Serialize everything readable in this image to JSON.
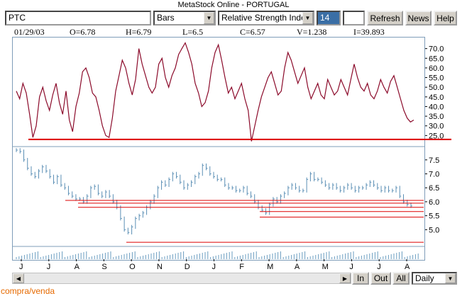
{
  "window": {
    "title": "MetaStock Online - PORTUGAL"
  },
  "toolbar": {
    "symbol_value": "PTC",
    "chart_type_selected": "Bars",
    "indicator_selected": "Relative Strength Index",
    "period_value": "14",
    "extra_field_value": "",
    "refresh_label": "Refresh",
    "news_label": "News",
    "help_label": "Help"
  },
  "quote": {
    "date": "01/29/03",
    "open": "O=6.78",
    "high": "H=6.79",
    "low": "L=6.5",
    "close": "C=6.57",
    "volume": "V=1.238",
    "indicator": "I=39.893"
  },
  "chart_data": [
    {
      "type": "line",
      "panel": "indicator",
      "ylim": [
        20,
        75
      ],
      "y_ticks": [
        "70.0",
        "65.0",
        "60.0",
        "55.0",
        "50.0",
        "45.0",
        "40.0",
        "35.0",
        "30.0",
        "25.0"
      ],
      "values": [
        48,
        44,
        52,
        47,
        36,
        24,
        30,
        45,
        50,
        43,
        38,
        46,
        52,
        42,
        36,
        48,
        33,
        27,
        40,
        47,
        58,
        60,
        55,
        47,
        45,
        38,
        30,
        25,
        24,
        34,
        48,
        56,
        64,
        60,
        52,
        46,
        54,
        70,
        62,
        56,
        50,
        47,
        50,
        62,
        65,
        55,
        50,
        56,
        60,
        67,
        70,
        73,
        68,
        62,
        52,
        47,
        40,
        42,
        48,
        60,
        68,
        72,
        64,
        55,
        47,
        50,
        44,
        48,
        52,
        44,
        38,
        22,
        30,
        38,
        45,
        50,
        55,
        58,
        52,
        46,
        48,
        60,
        68,
        64,
        58,
        52,
        56,
        60,
        50,
        44,
        48,
        52,
        46,
        44,
        54,
        50,
        46,
        48,
        54,
        50,
        46,
        54,
        62,
        55,
        50,
        48,
        52,
        46,
        44,
        48,
        54,
        50,
        47,
        53,
        56,
        50,
        44,
        38,
        34,
        32,
        33
      ],
      "annotations": [
        {
          "type": "horizontal-line",
          "value": 23,
          "color": "#dd0000"
        }
      ]
    },
    {
      "type": "bar",
      "panel": "price",
      "ylim": [
        4.4,
        7.9
      ],
      "y_ticks": [
        "7.5",
        "7.0",
        "6.5",
        "6.0",
        "5.5",
        "5.0"
      ],
      "values": [
        7.85,
        7.8,
        7.5,
        7.2,
        7.0,
        6.9,
        7.1,
        7.25,
        7.1,
        6.9,
        6.7,
        6.9,
        6.6,
        6.5,
        6.3,
        6.2,
        6.1,
        6.1,
        6.0,
        6.2,
        6.5,
        6.55,
        6.3,
        6.2,
        6.35,
        6.2,
        6.0,
        5.8,
        5.4,
        5.0,
        4.9,
        5.1,
        5.4,
        5.5,
        5.6,
        5.8,
        6.0,
        6.2,
        6.5,
        6.7,
        6.6,
        6.8,
        7.0,
        6.9,
        6.7,
        6.5,
        6.6,
        6.7,
        6.9,
        7.0,
        7.3,
        7.2,
        7.0,
        6.9,
        6.8,
        6.8,
        6.6,
        6.5,
        6.5,
        6.4,
        6.4,
        6.5,
        6.3,
        6.2,
        6.0,
        5.8,
        5.7,
        5.6,
        5.9,
        6.1,
        6.0,
        6.2,
        6.3,
        6.5,
        6.6,
        6.5,
        6.4,
        6.4,
        6.8,
        7.0,
        6.8,
        6.8,
        6.7,
        6.6,
        6.5,
        6.6,
        6.5,
        6.4,
        6.5,
        6.6,
        6.5,
        6.4,
        6.5,
        6.5,
        6.6,
        6.7,
        6.6,
        6.5,
        6.4,
        6.5,
        6.4,
        6.4,
        6.5,
        6.2,
        6.0,
        5.9,
        5.85
      ],
      "annotations": [
        {
          "type": "horizontal-line",
          "value": 6.05,
          "color": "#dd0000"
        },
        {
          "type": "horizontal-line",
          "value": 5.95,
          "color": "#dd0000"
        },
        {
          "type": "horizontal-line",
          "value": 5.8,
          "color": "#dd0000"
        },
        {
          "type": "horizontal-line",
          "value": 5.65,
          "color": "#dd0000"
        },
        {
          "type": "horizontal-line",
          "value": 5.45,
          "color": "#dd0000"
        },
        {
          "type": "horizontal-line",
          "value": 4.55,
          "color": "#dd0000"
        }
      ]
    },
    {
      "type": "bar",
      "panel": "volume",
      "x_ticks": [
        "J",
        "J",
        "A",
        "S",
        "O",
        "N",
        "D",
        "J",
        "F",
        "M",
        "A",
        "M",
        "J",
        "J",
        "A"
      ]
    }
  ],
  "navigation": {
    "in_label": "In",
    "out_label": "Out",
    "all_label": "All",
    "interval_selected": "Daily"
  },
  "footer": {
    "label": "compra/venda"
  },
  "colors": {
    "rsi_line": "#8b0a2a",
    "price_bars": "#5b8fb5",
    "volume_bars": "#6a9cc0",
    "signal_lines": "#dd0000",
    "panel_border": "#7f9db9"
  }
}
